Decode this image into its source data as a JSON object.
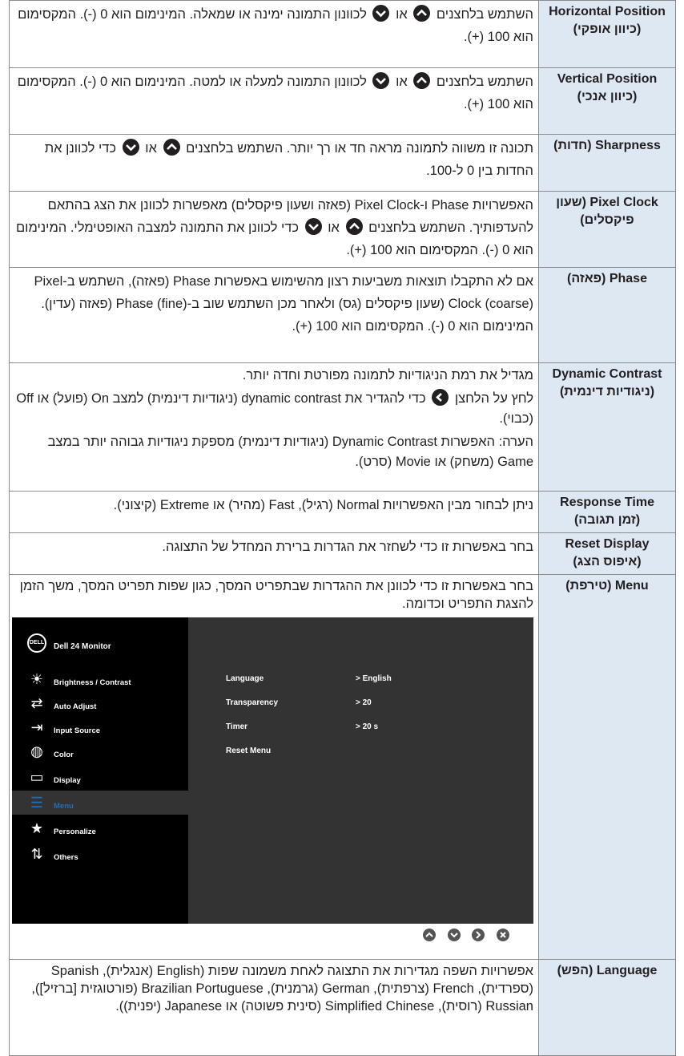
{
  "rows": [
    {
      "label_en": "Horizontal Position",
      "label_he": "(כיוון אופקי)",
      "desc_a": "השתמש בלחצנים",
      "desc_b": "או",
      "desc_c": "לכוונון התמונה ימינה או שמאלה. המינימום הוא 0 (-). המקסימום הוא 100 (+)."
    },
    {
      "label_en": "Vertical Position",
      "label_he": "(כיוון אנכי)",
      "desc_a": "השתמש בלחצנים",
      "desc_b": "או",
      "desc_c": "לכוונון התמונה למעלה או למטה. המינימום הוא 0 (-). המקסימום הוא 100 (+)."
    },
    {
      "label_en": "Sharpness",
      "label_he": "(חדות)",
      "desc_a": "תכונה זו משווה לתמונה מראה חד או רך יותר. השתמש בלחצנים",
      "desc_b": "או",
      "desc_c": "כדי לכוונן את החדות בין 0 ל-100."
    },
    {
      "label_en": "Pixel Clock",
      "label_he": "(שעון פיקסלים)",
      "desc_a": "האפשרויות Phase ו-Pixel Clock (פאזה ושעון פיקסלים) מאפשרות לכוונן את הצג בהתאם להעדפותיך. השתמש בלחצנים",
      "desc_b": "או",
      "desc_c": "כדי לכוונן את התמונה למצבה האופטימלי. המינימום הוא 0 (-). המקסימום הוא 100 (+)."
    },
    {
      "label_en": "Phase",
      "label_he": "(פאזה)",
      "desc": "אם לא התקבלו תוצאות משביעות רצון מהשימוש באפשרות Phase (פאזה), השתמש ב-Pixel Clock (coarse) (שעון פיקסלים (גס) ולאחר מכן השתמש שוב ב-Phase (fine) (פאזה (עדין). המינימום הוא 0 (-). המקסימום הוא 100 (+)."
    },
    {
      "label_en": "Dynamic Contrast",
      "label_he": "(ניגודיות דינמית)",
      "desc1": "מגדיל את רמת הניגודיות לתמונה מפורטת וחדה יותר.",
      "desc2_a": "לחץ על הלחצן",
      "desc2_b": "כדי להגדיר את dynamic contrast (ניגודיות דינמית) למצב On (פועל) או  Off (כבוי).",
      "desc3": "הערה: האפשרות Dynamic Contrast (ניגודיות דינמית) מספקת ניגודיות גבוהה יותר במצב Game (משחק) או Movie (סרט)."
    },
    {
      "label_en": "Response Time",
      "label_he": "(זמן תגובה)",
      "desc": "ניתן לבחור מבין האפשרויות Normal (רגיל), Fast (מהיר) או Extreme (קיצוני)."
    },
    {
      "label_en": "Reset Display",
      "label_he": "(איפוס הצג)",
      "desc": "בחר באפשרות זו כדי לשחזר את הגדרות ברירת המחדל של התצוגה."
    },
    {
      "label_en": "Menu",
      "label_he": "(טירפת)",
      "desc": "בחר באפשרות זו כדי לכוונן את ההגדרות שבתפריט המסך, כגון שפות תפריט המסך, משך הזמן להצגת התפריט וכדומה."
    },
    {
      "label_en": "Language",
      "label_he": "(הפש)",
      "desc": "אפשרויות השפה מגדירות את התצוגה לאחת משמונה שפות (English (אנגלית), Spanish (ספרדית), French (צרפתית), German (גרמנית), Brazilian Portuguese (פורטוגזית [ברזיל]), Russian (רוסית), Simplified Chinese (סינית פשוטה) או Japanese (יפנית))."
    }
  ],
  "osd": {
    "logo": "DELL",
    "title": "Dell 24 Monitor",
    "sidebar": [
      {
        "label": "Brightness / Contrast",
        "icon": "brightness-icon"
      },
      {
        "label": "Auto Adjust",
        "icon": "auto-adjust-icon"
      },
      {
        "label": "Input Source",
        "icon": "input-source-icon"
      },
      {
        "label": "Color",
        "icon": "color-icon"
      },
      {
        "label": "Display",
        "icon": "display-icon"
      },
      {
        "label": "Menu",
        "icon": "menu-icon",
        "selected": true
      },
      {
        "label": "Personalize",
        "icon": "star-icon"
      },
      {
        "label": "Others",
        "icon": "others-icon"
      }
    ],
    "settings": [
      {
        "name": "Language",
        "value": ">  English"
      },
      {
        "name": "Transparency",
        "value": ">  20"
      },
      {
        "name": "Timer",
        "value": ">  20 s"
      },
      {
        "name": "Reset Menu",
        "value": ""
      }
    ],
    "accent": "#1f6fb8"
  }
}
